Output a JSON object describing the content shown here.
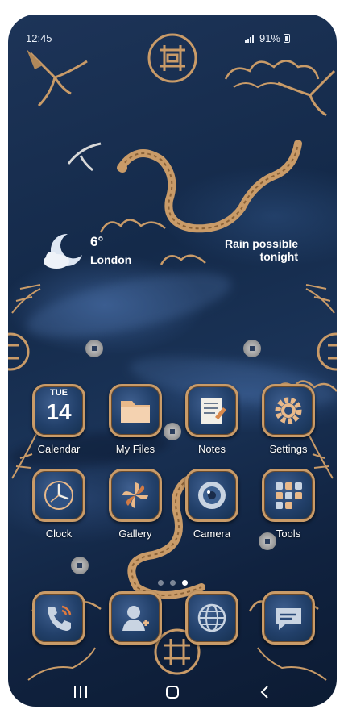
{
  "status_bar": {
    "time": "12:45",
    "battery": "91%"
  },
  "weather": {
    "temperature": "6°",
    "city": "London",
    "forecast_line1": "Rain possible",
    "forecast_line2": "tonight"
  },
  "calendar_icon": {
    "day": "TUE",
    "date": "14"
  },
  "apps_row1": [
    {
      "label": "Calendar"
    },
    {
      "label": "My Files"
    },
    {
      "label": "Notes"
    },
    {
      "label": "Settings"
    }
  ],
  "apps_row2": [
    {
      "label": "Clock"
    },
    {
      "label": "Gallery"
    },
    {
      "label": "Camera"
    },
    {
      "label": "Tools"
    }
  ],
  "dock": [
    {
      "icon": "phone-icon"
    },
    {
      "icon": "contacts-icon"
    },
    {
      "icon": "internet-icon"
    },
    {
      "icon": "messages-icon"
    }
  ],
  "page_indicator": {
    "pages": 3,
    "active": 3
  },
  "colors": {
    "accent_gold": "#c99b68",
    "background_navy": "#142a4a",
    "text": "#ffffff"
  }
}
